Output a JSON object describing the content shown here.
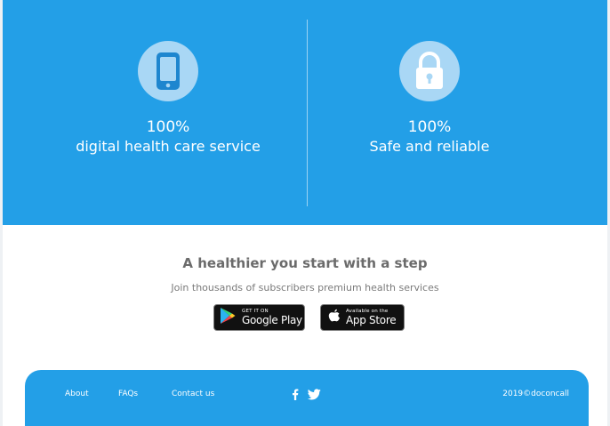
{
  "features": [
    {
      "percent": "100%",
      "label": "digital health care service",
      "icon": "smartphone-icon"
    },
    {
      "percent": "100%",
      "label": "Safe and reliable",
      "icon": "lock-icon"
    }
  ],
  "cta": {
    "headline": "A healthier you start with a step",
    "subtext": "Join thousands of subscribers premium health services"
  },
  "stores": {
    "google_play": {
      "small": "GET IT ON",
      "big": "Google Play"
    },
    "app_store": {
      "small": "Available on the",
      "big": "App Store"
    }
  },
  "footer": {
    "links": [
      "About",
      "FAQs",
      "Contact us"
    ],
    "social": [
      "facebook-icon",
      "twitter-icon"
    ],
    "copyright": "2019©doconcall"
  },
  "colors": {
    "brand_blue": "#239fe7",
    "icon_circle": "#a9d7f5",
    "text_gray": "#6b6b6b"
  }
}
